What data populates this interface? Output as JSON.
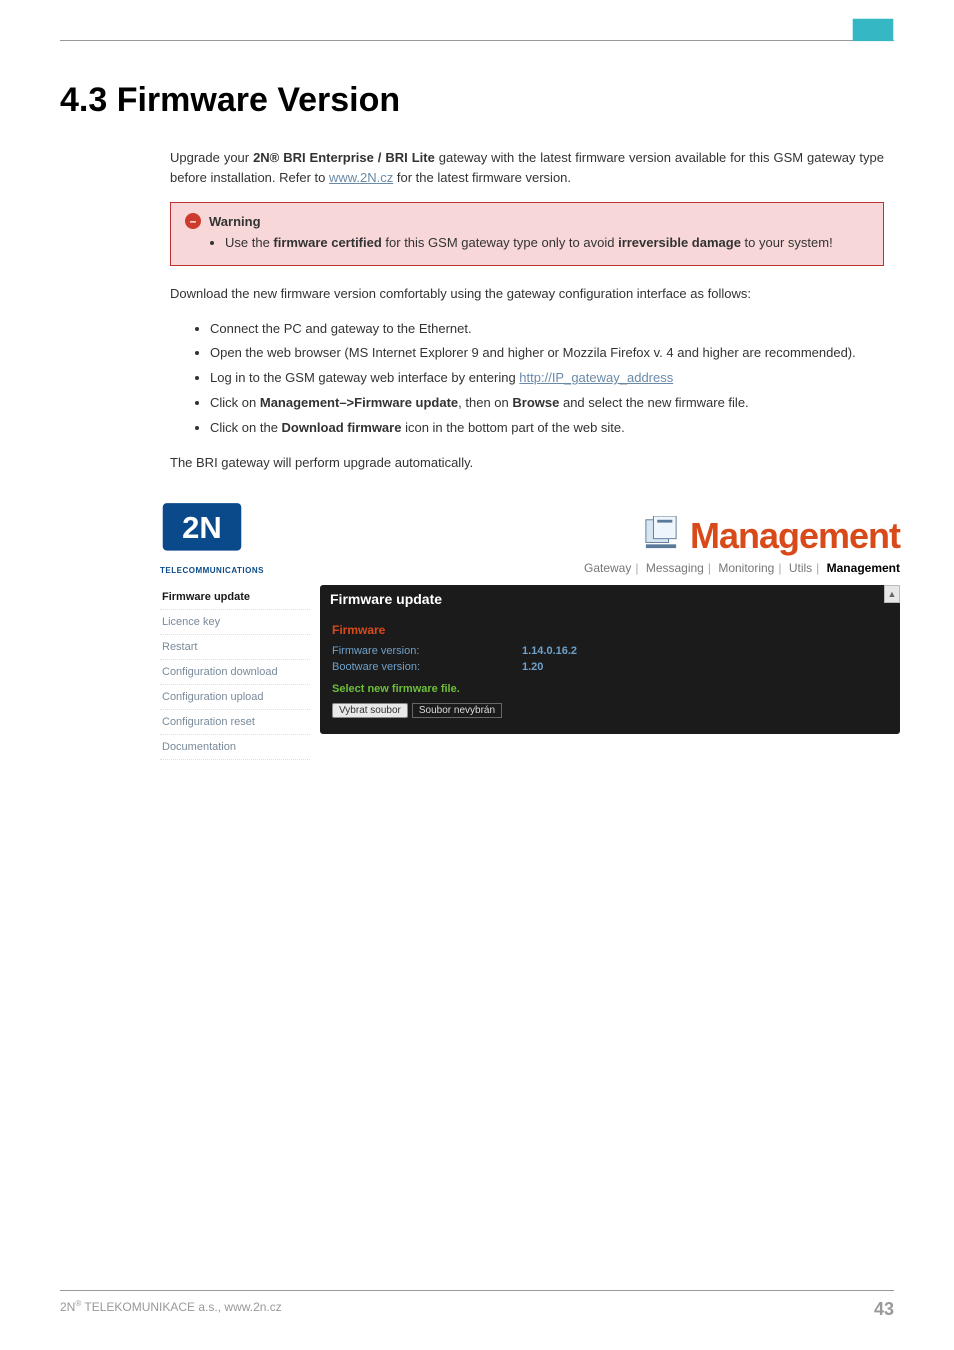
{
  "header": {
    "logo_alt": "2N"
  },
  "title": "4.3 Firmware Version",
  "intro": {
    "pre": "Upgrade your ",
    "prod": "2N® BRI Enterprise / BRI Lite",
    "mid": " gateway with the latest firmware version available for this GSM gateway type before installation. Refer to ",
    "link": "www.2N.cz",
    "post": " for the latest firmware version."
  },
  "warning": {
    "label": "Warning",
    "li_pre": "Use the ",
    "li_b1": "firmware certified",
    "li_mid": " for this GSM gateway type only to avoid ",
    "li_b2": "irreversible damage",
    "li_post": " to your system!"
  },
  "para2": "Download the new firmware version comfortably using the gateway configuration interface as follows:",
  "steps": {
    "s1": "Connect the PC and gateway to the Ethernet.",
    "s2": "Open the web browser (MS Internet Explorer 9 and higher or Mozzila Firefox v. 4 and higher are recommended).",
    "s3_pre": "Log in to the GSM gateway web interface by entering ",
    "s3_link": "http://IP_gateway_address",
    "s4_pre": "Click on ",
    "s4_b1": "Management–>Firmware update",
    "s4_mid": ", then on ",
    "s4_b2": "Browse",
    "s4_post": " and select the new firmware file.",
    "s5_pre": "Click on the ",
    "s5_b": "Download firmware",
    "s5_post": " icon in the bottom part of the web site."
  },
  "para3": "The BRI gateway will perform upgrade automatically.",
  "screenshot": {
    "logo_sub": "TELECOMMUNICATIONS",
    "title": "Management",
    "tabs": {
      "t1": "Gateway",
      "t2": "Messaging",
      "t3": "Monitoring",
      "t4": "Utils",
      "t5": "Management"
    },
    "side": {
      "i1": "Firmware update",
      "i2": "Licence key",
      "i3": "Restart",
      "i4": "Configuration download",
      "i5": "Configuration upload",
      "i6": "Configuration reset",
      "i7": "Documentation"
    },
    "panel": {
      "title": "Firmware update",
      "section": "Firmware",
      "row1_label": "Firmware version:",
      "row1_value": "1.14.0.16.2",
      "row2_label": "Bootware version:",
      "row2_value": "1.20",
      "select_label": "Select new firmware file.",
      "file_button": "Vybrat soubor",
      "file_text": "Soubor nevybrán"
    }
  },
  "footer": {
    "left_pre": "2N",
    "left_sup": "®",
    "left_post": " TELEKOMUNIKACE a.s., www.2n.cz",
    "page": "43"
  }
}
